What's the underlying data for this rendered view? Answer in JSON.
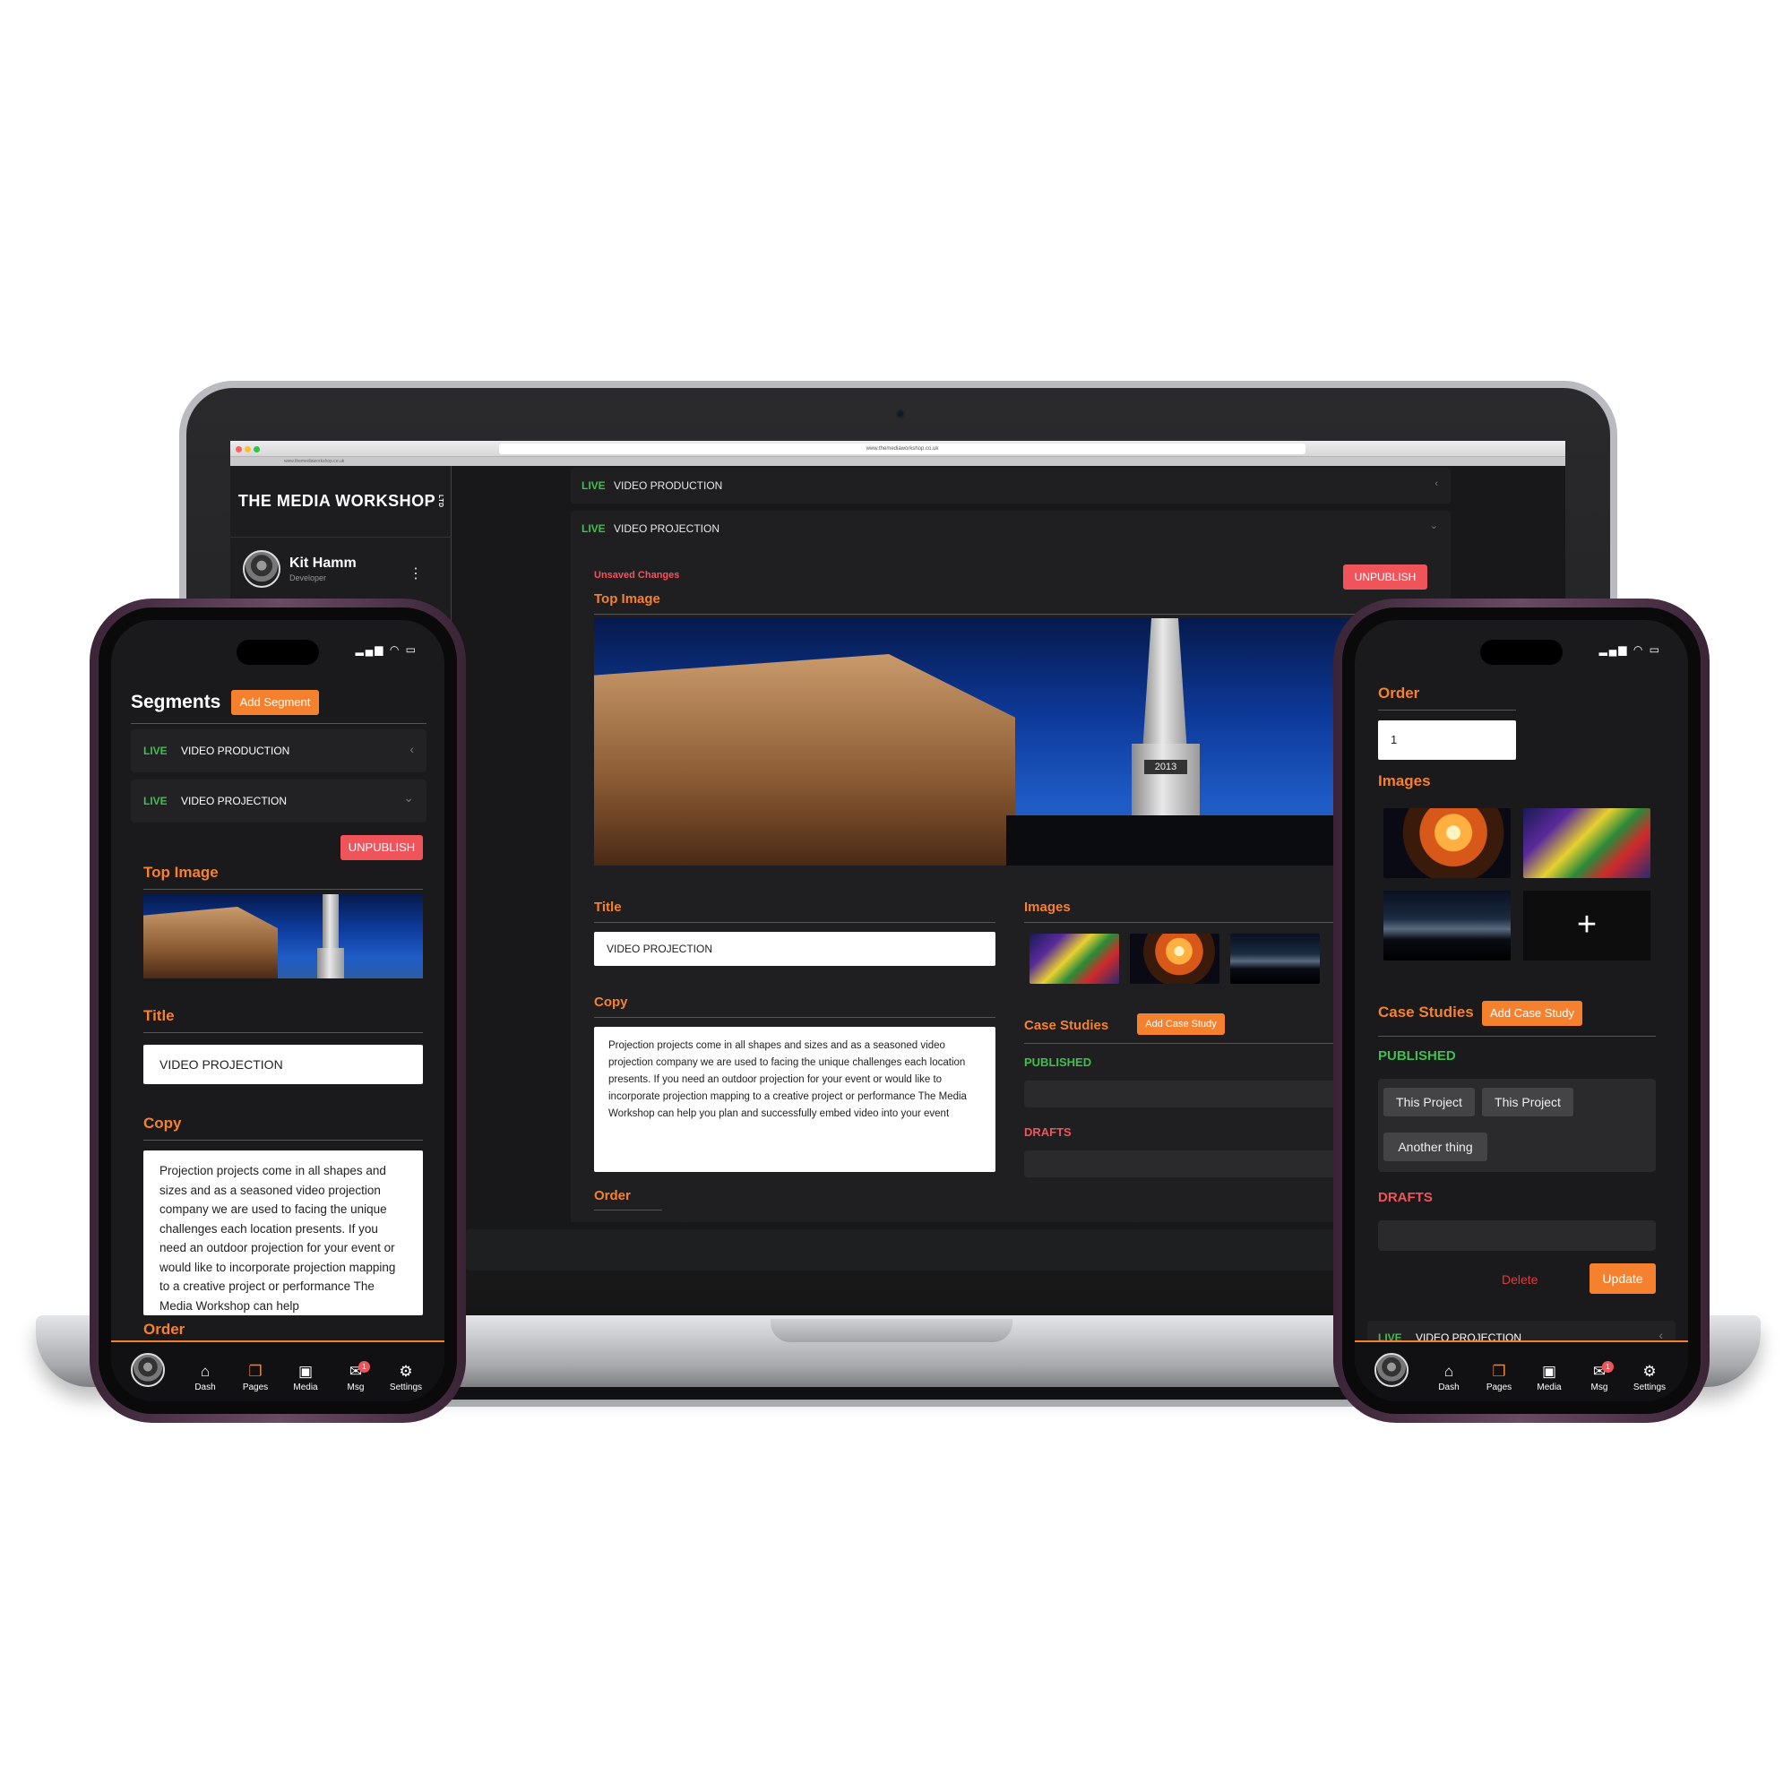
{
  "laptop": {
    "url": "www.themediaworkshop.co.uk",
    "tab_url": "www.themediaworkshop.co.uk",
    "brand": "THE MEDIA WORKSHOP",
    "brand_suffix": "LTD",
    "user": {
      "name": "Kit Hamm",
      "role": "Developer"
    },
    "segments": [
      {
        "status": "LIVE",
        "name": "VIDEO PRODUCTION"
      },
      {
        "status": "LIVE",
        "name": "VIDEO PROJECTION"
      }
    ],
    "unsaved": "Unsaved Changes",
    "unpublish": "UNPUBLISH",
    "top_image_label": "Top Image",
    "title_label": "Title",
    "title_value": "VIDEO PROJECTION",
    "copy_label": "Copy",
    "copy_text": "Projection projects come in all shapes and sizes and as a seasoned video projection company we are used to facing the unique challenges each location presents. If you need an outdoor projection for your event or would like to incorporate projection mapping to a creative project or performance The Media Workshop can help you plan and successfully embed video into your event",
    "order_label": "Order",
    "images_label": "Images",
    "case_studies_label": "Case Studies",
    "add_case_study": "Add Case Study",
    "published_label": "PUBLISHED",
    "drafts_label": "DRAFTS",
    "image_year": "2013"
  },
  "phone_left": {
    "heading": "Segments",
    "add_segment": "Add Segment",
    "segments": [
      {
        "status": "LIVE",
        "name": "VIDEO PRODUCTION"
      },
      {
        "status": "LIVE",
        "name": "VIDEO PROJECTION"
      }
    ],
    "unpublish": "UNPUBLISH",
    "top_image_label": "Top Image",
    "title_label": "Title",
    "title_value": "VIDEO PROJECTION",
    "copy_label": "Copy",
    "copy_text": "Projection projects come in all shapes and sizes and as a seasoned video projection company we are used to facing the unique challenges each location presents. If you need an outdoor projection for your event or would like to incorporate projection mapping to a creative project or performance The Media Workshop can help",
    "order_label": "Order"
  },
  "phone_right": {
    "order_label": "Order",
    "order_value": "1",
    "images_label": "Images",
    "add_icon": "+",
    "case_studies_label": "Case Studies",
    "add_case_study": "Add Case Study",
    "published_label": "PUBLISHED",
    "chips": [
      "This Project",
      "This Project",
      "Another thing"
    ],
    "drafts_label": "DRAFTS",
    "delete": "Delete",
    "update": "Update",
    "bottom_segment": {
      "status": "LIVE",
      "name": "VIDEO PROJECTION"
    }
  },
  "tabbar": {
    "items": [
      {
        "label": "Dash",
        "icon": "home-icon"
      },
      {
        "label": "Pages",
        "icon": "pages-icon"
      },
      {
        "label": "Media",
        "icon": "image-icon"
      },
      {
        "label": "Msg",
        "icon": "message-icon",
        "badge": "1"
      },
      {
        "label": "Settings",
        "icon": "gear-icon"
      }
    ]
  },
  "colors": {
    "accent": "#f5812f",
    "live": "#3fbf4f",
    "danger": "#f0545b",
    "bg": "#1a1a1c"
  }
}
